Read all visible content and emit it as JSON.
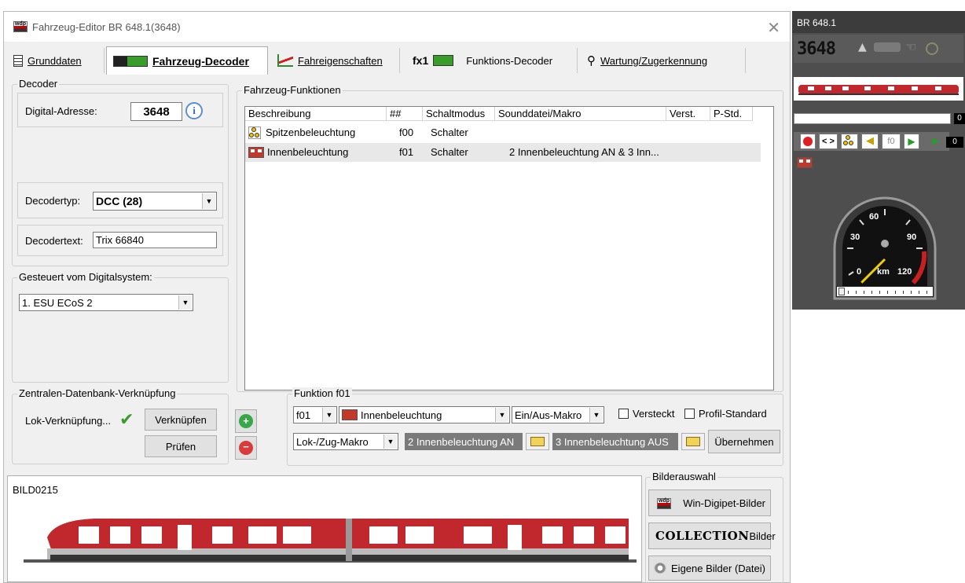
{
  "window": {
    "title": "Fahrzeug-Editor BR 648.1(3648)",
    "close_glyph": "✕"
  },
  "tabs": [
    {
      "label": "Grunddaten"
    },
    {
      "label": "Fahrzeug-Decoder"
    },
    {
      "label": "Fahreigenschaften"
    },
    {
      "label": "Funktions-Decoder",
      "prefix": "fx1"
    },
    {
      "label": "Wartung/Zugerkennung"
    }
  ],
  "decoder": {
    "legend": "Decoder",
    "address_label": "Digital-Adresse:",
    "address_value": "3648",
    "info_glyph": "i",
    "type_label": "Decodertyp:",
    "type_value": "DCC (28)",
    "text_label": "Decodertext:",
    "text_value": "Trix 66840"
  },
  "digital_system": {
    "legend": "Gesteuert vom Digitalsystem:",
    "value": "1. ESU ECoS 2"
  },
  "central_db": {
    "legend": "Zentralen-Datenbank-Verknüpfung",
    "loco_link_label": "Lok-Verknüpfung...",
    "link_button": "Verknüpfen",
    "check_button": "Prüfen"
  },
  "functions": {
    "legend": "Fahrzeug-Funktionen",
    "columns": [
      "Beschreibung",
      "##",
      "Schaltmodus",
      "Sounddatei/Makro",
      "Verst.",
      "P-Std."
    ],
    "rows": [
      {
        "description": "Spitzenbeleuchtung",
        "num": "f00",
        "mode": "Schalter",
        "sound": "",
        "icon": "lights-icon"
      },
      {
        "description": "Innenbeleuchtung",
        "num": "f01",
        "mode": "Schalter",
        "sound": "2 Innenbeleuchtung AN & 3 Inn...",
        "icon": "interior-light-icon"
      }
    ]
  },
  "function_detail": {
    "legend": "Funktion f01",
    "fn_value": "f01",
    "name_value": "Innenbeleuchtung",
    "mode_value": "Ein/Aus-Makro",
    "hidden_label": "Versteckt",
    "profile_label": "Profil-Standard",
    "macro_type_value": "Lok-/Zug-Makro",
    "macro_on": "2 Innenbeleuchtung AN",
    "macro_off": "3 Innenbeleuchtung AUS",
    "apply_button": "Übernehmen"
  },
  "image_area": {
    "image_name": "BILD0215",
    "picker_legend": "Bilderauswahl",
    "btn_wdp": "Win-Digipet-Bilder",
    "btn_collection_logo": "COLLECTION",
    "btn_collection": "Bilder",
    "btn_own": "Eigene Bilder (Datei)"
  },
  "control_panel": {
    "title": "BR 648.1",
    "address_display": "3648",
    "speed_value": "0",
    "speed_value2": "0",
    "f0_label": "f0",
    "speedo_labels": [
      "30",
      "60",
      "90",
      "km",
      "120",
      "0"
    ],
    "speed_kmh": 0
  },
  "colors": {
    "train_red": "#c0282d",
    "accent_green": "#3a9c2a"
  }
}
